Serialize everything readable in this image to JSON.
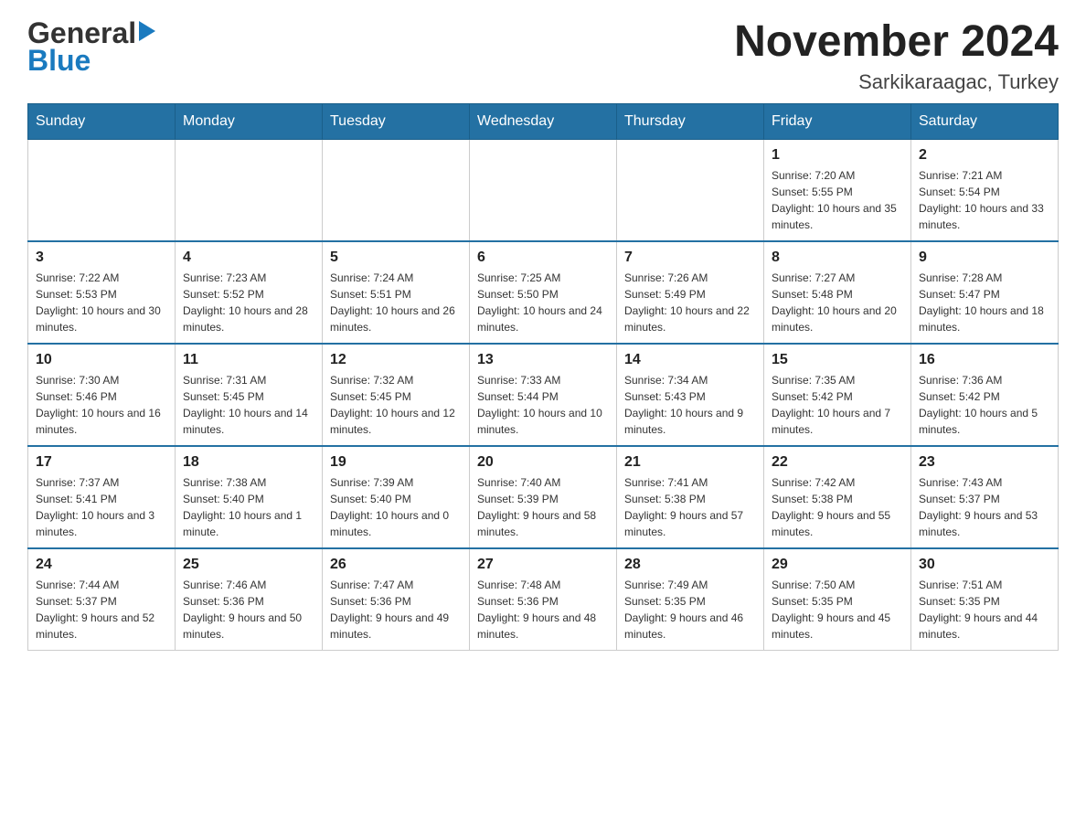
{
  "header": {
    "month_title": "November 2024",
    "location": "Sarkikaraagac, Turkey"
  },
  "weekdays": [
    "Sunday",
    "Monday",
    "Tuesday",
    "Wednesday",
    "Thursday",
    "Friday",
    "Saturday"
  ],
  "weeks": [
    [
      {
        "day": "",
        "sunrise": "",
        "sunset": "",
        "daylight": ""
      },
      {
        "day": "",
        "sunrise": "",
        "sunset": "",
        "daylight": ""
      },
      {
        "day": "",
        "sunrise": "",
        "sunset": "",
        "daylight": ""
      },
      {
        "day": "",
        "sunrise": "",
        "sunset": "",
        "daylight": ""
      },
      {
        "day": "",
        "sunrise": "",
        "sunset": "",
        "daylight": ""
      },
      {
        "day": "1",
        "sunrise": "Sunrise: 7:20 AM",
        "sunset": "Sunset: 5:55 PM",
        "daylight": "Daylight: 10 hours and 35 minutes."
      },
      {
        "day": "2",
        "sunrise": "Sunrise: 7:21 AM",
        "sunset": "Sunset: 5:54 PM",
        "daylight": "Daylight: 10 hours and 33 minutes."
      }
    ],
    [
      {
        "day": "3",
        "sunrise": "Sunrise: 7:22 AM",
        "sunset": "Sunset: 5:53 PM",
        "daylight": "Daylight: 10 hours and 30 minutes."
      },
      {
        "day": "4",
        "sunrise": "Sunrise: 7:23 AM",
        "sunset": "Sunset: 5:52 PM",
        "daylight": "Daylight: 10 hours and 28 minutes."
      },
      {
        "day": "5",
        "sunrise": "Sunrise: 7:24 AM",
        "sunset": "Sunset: 5:51 PM",
        "daylight": "Daylight: 10 hours and 26 minutes."
      },
      {
        "day": "6",
        "sunrise": "Sunrise: 7:25 AM",
        "sunset": "Sunset: 5:50 PM",
        "daylight": "Daylight: 10 hours and 24 minutes."
      },
      {
        "day": "7",
        "sunrise": "Sunrise: 7:26 AM",
        "sunset": "Sunset: 5:49 PM",
        "daylight": "Daylight: 10 hours and 22 minutes."
      },
      {
        "day": "8",
        "sunrise": "Sunrise: 7:27 AM",
        "sunset": "Sunset: 5:48 PM",
        "daylight": "Daylight: 10 hours and 20 minutes."
      },
      {
        "day": "9",
        "sunrise": "Sunrise: 7:28 AM",
        "sunset": "Sunset: 5:47 PM",
        "daylight": "Daylight: 10 hours and 18 minutes."
      }
    ],
    [
      {
        "day": "10",
        "sunrise": "Sunrise: 7:30 AM",
        "sunset": "Sunset: 5:46 PM",
        "daylight": "Daylight: 10 hours and 16 minutes."
      },
      {
        "day": "11",
        "sunrise": "Sunrise: 7:31 AM",
        "sunset": "Sunset: 5:45 PM",
        "daylight": "Daylight: 10 hours and 14 minutes."
      },
      {
        "day": "12",
        "sunrise": "Sunrise: 7:32 AM",
        "sunset": "Sunset: 5:45 PM",
        "daylight": "Daylight: 10 hours and 12 minutes."
      },
      {
        "day": "13",
        "sunrise": "Sunrise: 7:33 AM",
        "sunset": "Sunset: 5:44 PM",
        "daylight": "Daylight: 10 hours and 10 minutes."
      },
      {
        "day": "14",
        "sunrise": "Sunrise: 7:34 AM",
        "sunset": "Sunset: 5:43 PM",
        "daylight": "Daylight: 10 hours and 9 minutes."
      },
      {
        "day": "15",
        "sunrise": "Sunrise: 7:35 AM",
        "sunset": "Sunset: 5:42 PM",
        "daylight": "Daylight: 10 hours and 7 minutes."
      },
      {
        "day": "16",
        "sunrise": "Sunrise: 7:36 AM",
        "sunset": "Sunset: 5:42 PM",
        "daylight": "Daylight: 10 hours and 5 minutes."
      }
    ],
    [
      {
        "day": "17",
        "sunrise": "Sunrise: 7:37 AM",
        "sunset": "Sunset: 5:41 PM",
        "daylight": "Daylight: 10 hours and 3 minutes."
      },
      {
        "day": "18",
        "sunrise": "Sunrise: 7:38 AM",
        "sunset": "Sunset: 5:40 PM",
        "daylight": "Daylight: 10 hours and 1 minute."
      },
      {
        "day": "19",
        "sunrise": "Sunrise: 7:39 AM",
        "sunset": "Sunset: 5:40 PM",
        "daylight": "Daylight: 10 hours and 0 minutes."
      },
      {
        "day": "20",
        "sunrise": "Sunrise: 7:40 AM",
        "sunset": "Sunset: 5:39 PM",
        "daylight": "Daylight: 9 hours and 58 minutes."
      },
      {
        "day": "21",
        "sunrise": "Sunrise: 7:41 AM",
        "sunset": "Sunset: 5:38 PM",
        "daylight": "Daylight: 9 hours and 57 minutes."
      },
      {
        "day": "22",
        "sunrise": "Sunrise: 7:42 AM",
        "sunset": "Sunset: 5:38 PM",
        "daylight": "Daylight: 9 hours and 55 minutes."
      },
      {
        "day": "23",
        "sunrise": "Sunrise: 7:43 AM",
        "sunset": "Sunset: 5:37 PM",
        "daylight": "Daylight: 9 hours and 53 minutes."
      }
    ],
    [
      {
        "day": "24",
        "sunrise": "Sunrise: 7:44 AM",
        "sunset": "Sunset: 5:37 PM",
        "daylight": "Daylight: 9 hours and 52 minutes."
      },
      {
        "day": "25",
        "sunrise": "Sunrise: 7:46 AM",
        "sunset": "Sunset: 5:36 PM",
        "daylight": "Daylight: 9 hours and 50 minutes."
      },
      {
        "day": "26",
        "sunrise": "Sunrise: 7:47 AM",
        "sunset": "Sunset: 5:36 PM",
        "daylight": "Daylight: 9 hours and 49 minutes."
      },
      {
        "day": "27",
        "sunrise": "Sunrise: 7:48 AM",
        "sunset": "Sunset: 5:36 PM",
        "daylight": "Daylight: 9 hours and 48 minutes."
      },
      {
        "day": "28",
        "sunrise": "Sunrise: 7:49 AM",
        "sunset": "Sunset: 5:35 PM",
        "daylight": "Daylight: 9 hours and 46 minutes."
      },
      {
        "day": "29",
        "sunrise": "Sunrise: 7:50 AM",
        "sunset": "Sunset: 5:35 PM",
        "daylight": "Daylight: 9 hours and 45 minutes."
      },
      {
        "day": "30",
        "sunrise": "Sunrise: 7:51 AM",
        "sunset": "Sunset: 5:35 PM",
        "daylight": "Daylight: 9 hours and 44 minutes."
      }
    ]
  ],
  "logo": {
    "general": "General",
    "blue": "Blue"
  }
}
